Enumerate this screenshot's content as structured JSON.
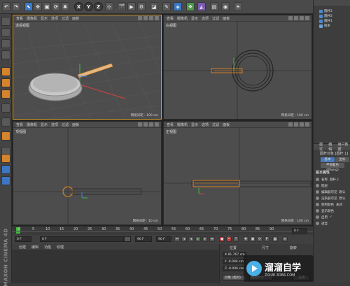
{
  "toolbar": {
    "buttons": [
      "undo",
      "redo",
      "select",
      "move",
      "scale",
      "rotate",
      "recent",
      "X",
      "Y",
      "Z",
      "coord",
      "render-view",
      "render",
      "render-settings",
      "cube",
      "pen",
      "subdivision",
      "array",
      "deformer",
      "scene",
      "camera",
      "light"
    ]
  },
  "viewports": [
    {
      "label": "透视视图",
      "scale": "网格间距 : 100 cm",
      "menu": [
        "查看",
        "摄像机",
        "显示",
        "选项",
        "过滤",
        "面板"
      ]
    },
    {
      "label": "右视图",
      "scale": "网格间距 : 100 cm",
      "menu": [
        "查看",
        "摄像机",
        "显示",
        "选项",
        "过滤",
        "面板"
      ]
    },
    {
      "label": "顶视图",
      "scale": "网格间距 : 10 cm",
      "menu": [
        "查看",
        "摄像机",
        "显示",
        "选项",
        "过滤",
        "面板"
      ]
    },
    {
      "label": "正视图",
      "scale": "网格间距 : 100 cm",
      "menu": [
        "查看",
        "摄像机",
        "显示",
        "选项",
        "过滤",
        "面板"
      ]
    }
  ],
  "timeline": {
    "ticks": [
      "0",
      "5",
      "10",
      "15",
      "20",
      "25",
      "30",
      "35",
      "40",
      "45",
      "50",
      "55",
      "60",
      "65",
      "70",
      "75",
      "80",
      "85",
      "90"
    ],
    "current_frame": "0 F",
    "start": "0 F",
    "start_field": "0 F",
    "end_field": "90 F",
    "end": "90 F"
  },
  "material_menu": [
    "创建",
    "编辑",
    "功能",
    "纹理"
  ],
  "coords": {
    "header_pos": "位置",
    "header_size": "尺寸",
    "header_rot": "旋转",
    "x": "X  81.767 cm",
    "y": "Y  -0.004 cm",
    "z": "Z  -0.006 cm",
    "mode": "对象 (相对)",
    "size_mode": "绝对尺寸",
    "apply": "应用"
  },
  "object_manager": {
    "items": [
      "圆杆2",
      "圆杆2",
      "圆杆1",
      "样条"
    ]
  },
  "attributes": {
    "menu": [
      "模式",
      "编辑",
      "用户数据"
    ],
    "title": "圆杆对象 [圆杆.1]",
    "tabs": [
      "基本",
      "坐标",
      "对象"
    ],
    "tab2": "平滑着色(Phong)",
    "section": "基本属性",
    "rows": [
      {
        "label": "名称",
        "value": "圆杆.1"
      },
      {
        "label": "图层",
        "value": ""
      },
      {
        "label": "编辑器可见",
        "value": "默认"
      },
      {
        "label": "渲染器可见",
        "value": "默认"
      },
      {
        "label": "使用颜色",
        "value": "关闭"
      },
      {
        "label": "显示颜色",
        "value": ""
      },
      {
        "label": "启用",
        "value": "✓"
      },
      {
        "label": "透显",
        "value": ""
      }
    ]
  },
  "brand": "MAXON CINEMA 4D",
  "watermark": {
    "title": "溜溜自学",
    "url": "ZIXUE.3D66.COM"
  },
  "colors": {
    "accent": "#d8a030",
    "selection": "#f08a20",
    "axis_x": "#d84040",
    "axis_y": "#40c040",
    "axis_z": "#4080ff"
  }
}
